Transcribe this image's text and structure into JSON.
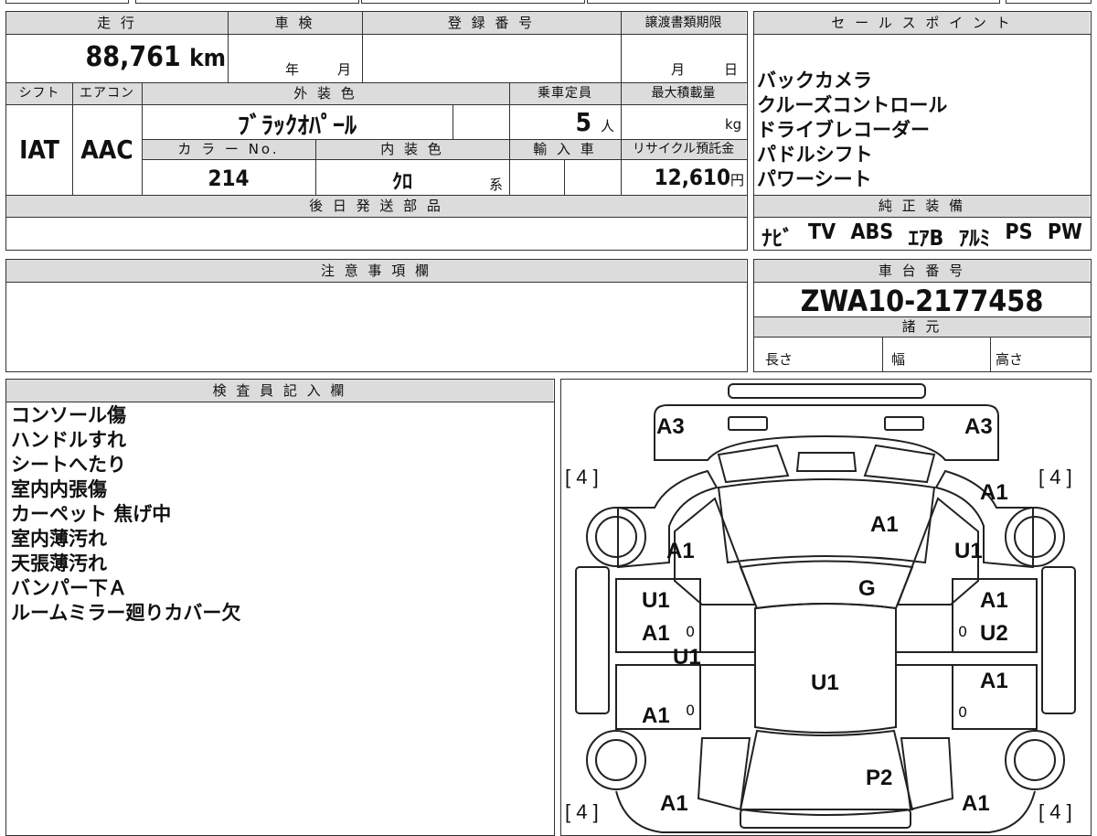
{
  "vehicle": {
    "mileage_label": "走 行",
    "mileage_value": "88,761",
    "mileage_unit": "km",
    "shaken_label": "車 検",
    "shaken_year": "年",
    "shaken_month": "月",
    "registration_label": "登 録 番 号",
    "transfer_label": "譲渡書類期限",
    "transfer_month": "月",
    "transfer_day": "日",
    "shift_label": "シフト",
    "shift_value": "IAT",
    "aircon_label": "エアコン",
    "aircon_value": "AAC",
    "exterior_label": "外 装 色",
    "exterior_value": "ﾌﾞﾗｯｸｵﾊﾟｰﾙ",
    "capacity_label": "乗車定員",
    "capacity_value": "5",
    "capacity_unit": "人",
    "maxload_label": "最大積載量",
    "maxload_unit": "kg",
    "color_no_label": "カ ラ ー No.",
    "color_no_value": "214",
    "interior_label": "内 装 色",
    "interior_value": "ｸﾛ",
    "interior_suffix": "系",
    "import_label": "輸 入 車",
    "recycle_label": "リサイクル預託金",
    "recycle_value": "12,610",
    "recycle_unit": "円",
    "later_parts_label": "後 日 発 送 部 品"
  },
  "sales": {
    "title": "セ ー ル ス ポ イ ン ト",
    "points": [
      "バックカメラ",
      "クルーズコントロール",
      "ドライブレコーダー",
      "パドルシフト",
      "パワーシート"
    ]
  },
  "equipment": {
    "title": "純 正 装 備",
    "items": [
      "ﾅﾋﾞ",
      "TV",
      "ABS",
      "ｴｱB",
      "ｱﾙﾐ",
      "PS",
      "PW"
    ]
  },
  "caution": {
    "title": "注 意 事 項 欄"
  },
  "chassis": {
    "title": "車 台 番 号",
    "number": "ZWA10-2177458",
    "specs_title": "諸 元",
    "length_label": "長さ",
    "width_label": "幅",
    "height_label": "高さ"
  },
  "inspector": {
    "title": "検 査 員 記 入 欄",
    "notes": [
      "コンソール傷",
      "ハンドルすれ",
      "シートへたり",
      "室内内張傷",
      "カーペット 焦げ中",
      "室内薄汚れ",
      "天張薄汚れ",
      "バンパー下Ａ",
      "ルームミラー廻りカバー欠"
    ]
  },
  "diagram": {
    "tire_marks": [
      "[ 4 ]",
      "[ 4 ]",
      "[ 4 ]",
      "[ 4 ]"
    ],
    "zeros": [
      "0",
      "0",
      "0",
      "0"
    ],
    "marks": {
      "front_left": "A3",
      "front_right": "A3",
      "hood": "A1",
      "fender_left": "A1",
      "fender_right": "A1",
      "fender_right_u": "U1",
      "windshield": "G",
      "door_fl_u": "U1",
      "door_fl_a": "A1",
      "door_fr_a": "A1",
      "door_fr_u": "U2",
      "pillar_left": "U1",
      "roof": "U1",
      "door_rl": "A1",
      "door_rr": "A1",
      "trunk": "P2",
      "quarter_left": "A1",
      "quarter_right": "A1"
    }
  }
}
